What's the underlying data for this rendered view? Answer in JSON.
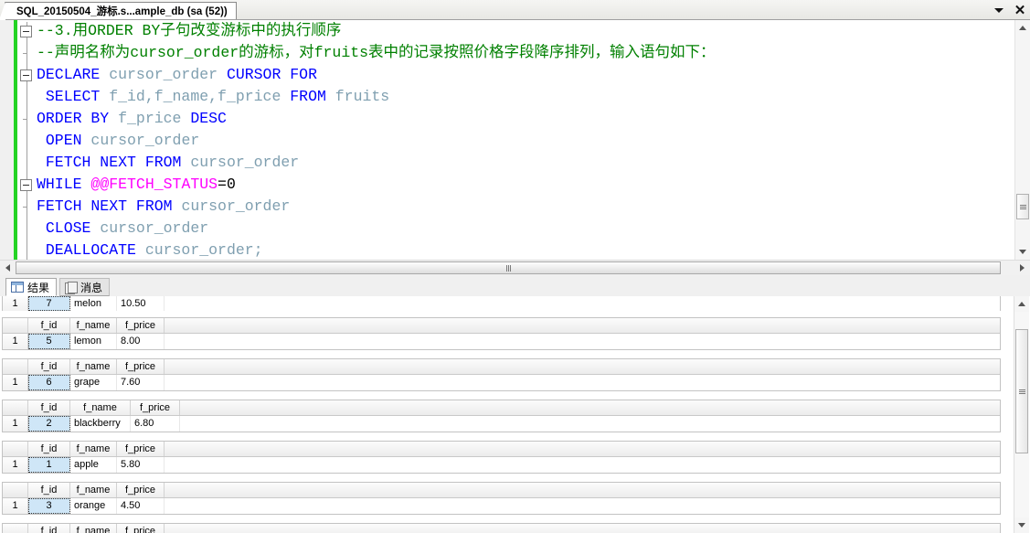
{
  "window": {
    "tab_title": "SQL_20150504_游标.s...ample_db (sa (52))",
    "caret_icon": "chevron-down-icon",
    "close_icon": "close-icon"
  },
  "editor": {
    "lines": [
      {
        "fold": "box",
        "parts": [
          {
            "t": "--3.用ORDER BY子句改变游标中的执行顺序",
            "c": "cmt"
          }
        ]
      },
      {
        "fold": "tick",
        "parts": [
          {
            "t": "--声明名称为cursor_order的游标，对fruits表中的记录按照价格字段降序排列，输入语句如下：",
            "c": "cmt"
          }
        ]
      },
      {
        "fold": "box",
        "parts": [
          {
            "t": "DECLARE",
            "c": "kw"
          },
          {
            "t": " ",
            "c": "op"
          },
          {
            "t": "cursor_order",
            "c": "id"
          },
          {
            "t": " ",
            "c": "op"
          },
          {
            "t": "CURSOR FOR",
            "c": "kw"
          }
        ]
      },
      {
        "fold": "none",
        "parts": [
          {
            "t": " SELECT",
            "c": "kw"
          },
          {
            "t": " ",
            "c": "op"
          },
          {
            "t": "f_id,f_name,f_price",
            "c": "id"
          },
          {
            "t": " ",
            "c": "op"
          },
          {
            "t": "FROM",
            "c": "kw"
          },
          {
            "t": " ",
            "c": "op"
          },
          {
            "t": "fruits",
            "c": "id"
          }
        ]
      },
      {
        "fold": "tick",
        "parts": [
          {
            "t": "ORDER BY",
            "c": "kw"
          },
          {
            "t": " ",
            "c": "op"
          },
          {
            "t": "f_price",
            "c": "id"
          },
          {
            "t": " ",
            "c": "op"
          },
          {
            "t": "DESC",
            "c": "kw"
          }
        ]
      },
      {
        "fold": "none",
        "parts": [
          {
            "t": " OPEN",
            "c": "kw"
          },
          {
            "t": " ",
            "c": "op"
          },
          {
            "t": "cursor_order",
            "c": "id"
          }
        ]
      },
      {
        "fold": "none",
        "parts": [
          {
            "t": " FETCH NEXT FROM",
            "c": "kw"
          },
          {
            "t": " ",
            "c": "op"
          },
          {
            "t": "cursor_order",
            "c": "id"
          }
        ]
      },
      {
        "fold": "box",
        "parts": [
          {
            "t": "WHILE",
            "c": "kw"
          },
          {
            "t": " ",
            "c": "op"
          },
          {
            "t": "@@FETCH_STATUS",
            "c": "sysv"
          },
          {
            "t": "=0",
            "c": "op"
          }
        ]
      },
      {
        "fold": "tick",
        "parts": [
          {
            "t": "FETCH NEXT FROM",
            "c": "kw"
          },
          {
            "t": " ",
            "c": "op"
          },
          {
            "t": "cursor_order",
            "c": "id"
          }
        ]
      },
      {
        "fold": "none",
        "parts": [
          {
            "t": " CLOSE",
            "c": "kw"
          },
          {
            "t": " ",
            "c": "op"
          },
          {
            "t": "cursor_order",
            "c": "id"
          }
        ]
      },
      {
        "fold": "none",
        "parts": [
          {
            "t": " DEALLOCATE",
            "c": "kw"
          },
          {
            "t": " ",
            "c": "op"
          },
          {
            "t": "cursor_order;",
            "c": "id"
          }
        ]
      }
    ]
  },
  "results": {
    "tabs": [
      {
        "label": "结果",
        "icon": "grid-icon",
        "active": true
      },
      {
        "label": "消息",
        "icon": "message-icon",
        "active": false
      }
    ],
    "columns": [
      "f_id",
      "f_name",
      "f_price"
    ],
    "partial_top_row": {
      "row_no": "1",
      "f_id": "7",
      "f_name": "melon",
      "f_price": "10.50"
    },
    "grids": [
      {
        "row_no": "1",
        "f_id": "5",
        "f_name": "lemon",
        "f_price": "8.00",
        "wide": false
      },
      {
        "row_no": "1",
        "f_id": "6",
        "f_name": "grape",
        "f_price": "7.60",
        "wide": false
      },
      {
        "row_no": "1",
        "f_id": "2",
        "f_name": "blackberry",
        "f_price": "6.80",
        "wide": true
      },
      {
        "row_no": "1",
        "f_id": "1",
        "f_name": "apple",
        "f_price": "5.80",
        "wide": false
      },
      {
        "row_no": "1",
        "f_id": "3",
        "f_name": "orange",
        "f_price": "4.50",
        "wide": false
      }
    ]
  },
  "colors": {
    "keyword": "#0000ff",
    "identifier": "#7f9fb0",
    "comment": "#008000",
    "system_variable": "#ff00ff",
    "change_bar": "#24d324",
    "cell_selection": "#cfe6f7"
  }
}
